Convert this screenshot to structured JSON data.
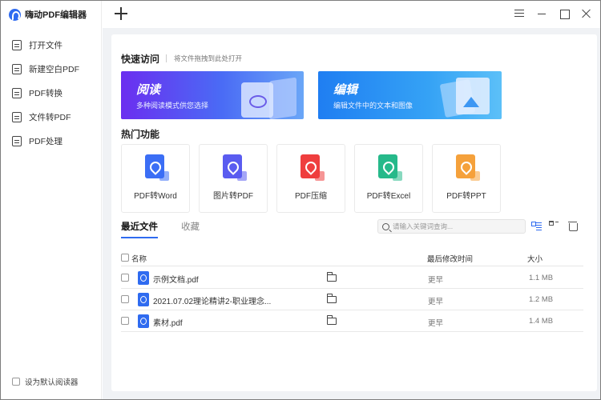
{
  "app": {
    "title": "嗨动PDF编辑器"
  },
  "sidebar": {
    "items": [
      {
        "label": "打开文件",
        "icon": "open-file-icon"
      },
      {
        "label": "新建空白PDF",
        "icon": "new-pdf-icon"
      },
      {
        "label": "PDF转换",
        "icon": "pdf-convert-icon"
      },
      {
        "label": "文件转PDF",
        "icon": "file-to-pdf-icon"
      },
      {
        "label": "PDF处理",
        "icon": "pdf-process-icon"
      }
    ],
    "default_reader": "设为默认阅读器"
  },
  "quick_access": {
    "title": "快速访问",
    "hint": "将文件拖拽到此处打开",
    "cards": [
      {
        "title": "阅读",
        "subtitle": "多种阅读模式供您选择"
      },
      {
        "title": "编辑",
        "subtitle": "编辑文件中的文本和图像"
      }
    ]
  },
  "hot_features": {
    "title": "热门功能",
    "items": [
      {
        "label": "PDF转Word",
        "color": "#3b6ef5"
      },
      {
        "label": "图片转PDF",
        "color": "#5a5cf0"
      },
      {
        "label": "PDF压缩",
        "color": "#ef3e3e"
      },
      {
        "label": "PDF转Excel",
        "color": "#26b98a"
      },
      {
        "label": "PDF转PPT",
        "color": "#f5a13b"
      }
    ]
  },
  "recent": {
    "tabs": [
      "最近文件",
      "收藏"
    ],
    "search_placeholder": "请输入关键词查询...",
    "columns": {
      "name": "名称",
      "modified": "最后修改时间",
      "size": "大小"
    },
    "rows": [
      {
        "name": "示例文档.pdf",
        "modified": "更早",
        "size": "1.1 MB"
      },
      {
        "name": "2021.07.02理论精讲2-职业理念...",
        "modified": "更早",
        "size": "1.2 MB"
      },
      {
        "name": "素材.pdf",
        "modified": "更早",
        "size": "1.4 MB"
      }
    ]
  },
  "colors": {
    "accent": "#2f6bf0",
    "background": "#f0f2f5"
  }
}
